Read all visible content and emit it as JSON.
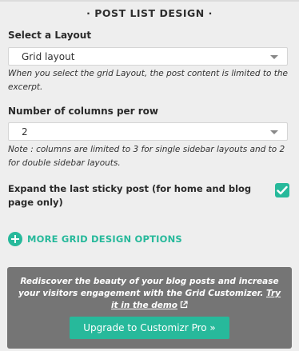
{
  "section": {
    "title": "· POST LIST DESIGN ·"
  },
  "layout": {
    "label": "Select a Layout",
    "selected": "Grid layout",
    "note": "When you select the grid Layout, the post content is limited to the excerpt."
  },
  "columns": {
    "label": "Number of columns per row",
    "selected": "2",
    "note": "Note : columns are limited to 3 for single sidebar layouts and to 2 for double sidebar layouts."
  },
  "sticky": {
    "label": "Expand the last sticky post (for home and blog page only)",
    "checked": true
  },
  "more_options": {
    "label": "MORE GRID DESIGN OPTIONS"
  },
  "promo": {
    "text": "Rediscover the beauty of your blog posts and increase your visitors engagement with the Grid Customizer.",
    "link_text": "Try it in the demo",
    "button_label": "Upgrade to Customizr Pro »"
  },
  "colors": {
    "accent": "#27b99b",
    "promo_bg": "#757575",
    "panel_bg": "#eeeeee"
  }
}
